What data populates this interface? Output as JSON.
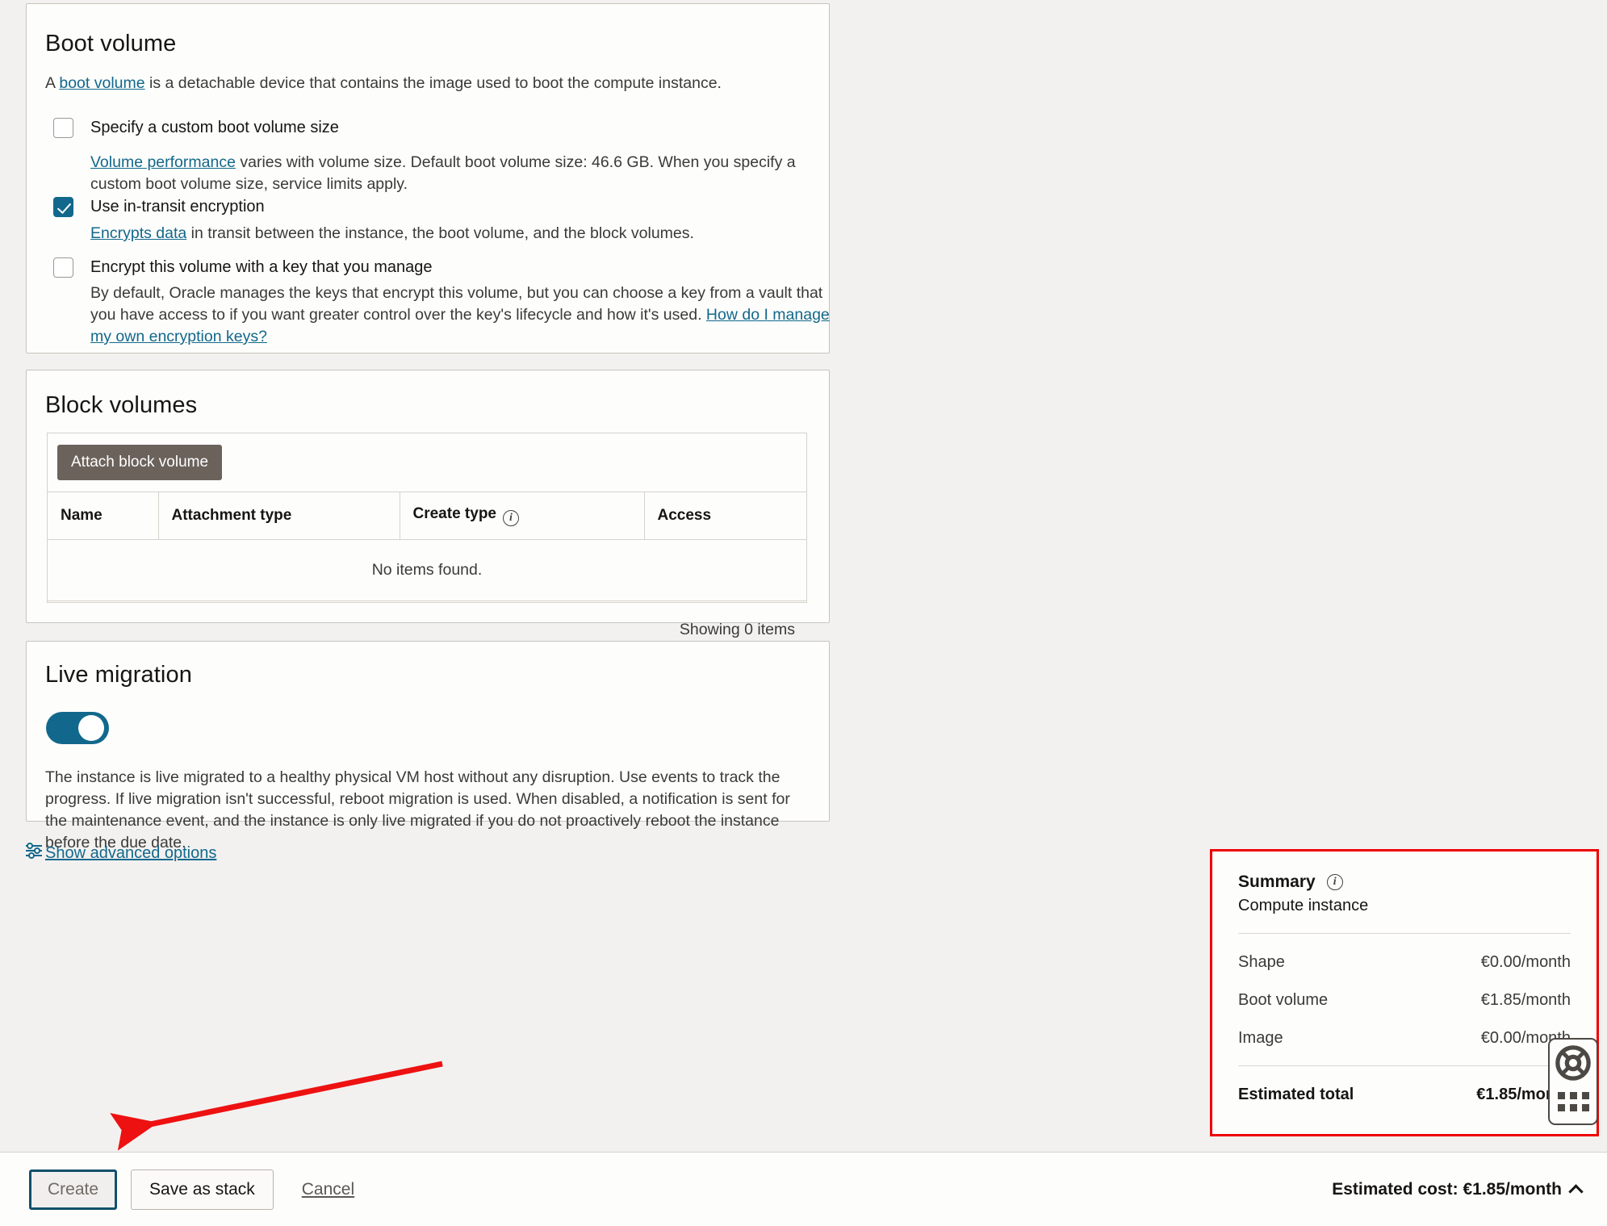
{
  "boot_volume": {
    "title": "Boot volume",
    "intro_prefix": "A ",
    "intro_link": "boot volume",
    "intro_suffix": " is a detachable device that contains the image used to boot the compute instance.",
    "custom_size": {
      "label": "Specify a custom boot volume size",
      "checked": false,
      "help_link": "Volume performance",
      "help_text": " varies with volume size. Default boot volume size: 46.6 GB. When you specify a custom boot volume size, service limits apply."
    },
    "in_transit": {
      "label": "Use in-transit encryption",
      "checked": true,
      "help_link": "Encrypts data",
      "help_text": " in transit between the instance, the boot volume, and the block volumes."
    },
    "own_key": {
      "label": "Encrypt this volume with a key that you manage",
      "checked": false,
      "help_text": "By default, Oracle manages the keys that encrypt this volume, but you can choose a key from a vault that you have access to if you want greater control over the key's lifecycle and how it's used. ",
      "help_link": "How do I manage my own encryption keys?"
    }
  },
  "block_volumes": {
    "title": "Block volumes",
    "attach_button": "Attach block volume",
    "columns": [
      "Name",
      "Attachment type",
      "Create type",
      "Access"
    ],
    "create_type_info_icon": "info-icon",
    "empty_message": "No items found.",
    "footer": "Showing 0 items"
  },
  "live_migration": {
    "title": "Live migration",
    "toggle_on": true,
    "description": "The instance is live migrated to a healthy physical VM host without any disruption. Use events to track the progress. If live migration isn't successful, reboot migration is used. When disabled, a notification is sent for the maintenance event, and the instance is only live migrated if you do not proactively reboot the instance before the due date."
  },
  "advanced_options": {
    "label": "Show advanced options",
    "icon": "sliders-icon"
  },
  "summary": {
    "title": "Summary",
    "info_icon": "info-icon",
    "subtitle": "Compute instance",
    "rows": [
      {
        "label": "Shape",
        "value": "€0.00/month"
      },
      {
        "label": "Boot volume",
        "value": "€1.85/month"
      },
      {
        "label": "Image",
        "value": "€0.00/month"
      }
    ],
    "total": {
      "label": "Estimated total",
      "value": "€1.85/month"
    },
    "highlight_color": "#ee0000"
  },
  "help_widget": {
    "icon": "lifebuoy-icon",
    "drag_handle": "grid-dots-icon"
  },
  "footer": {
    "create_label": "Create",
    "save_as_stack_label": "Save as stack",
    "cancel_label": "Cancel",
    "cost_label": "Estimated cost: €1.85/month",
    "collapse_icon": "chevron-up-icon"
  },
  "annotation": {
    "arrow_color": "#ee1111",
    "arrow_name": "red-arrow-pointing-to-create-button"
  }
}
